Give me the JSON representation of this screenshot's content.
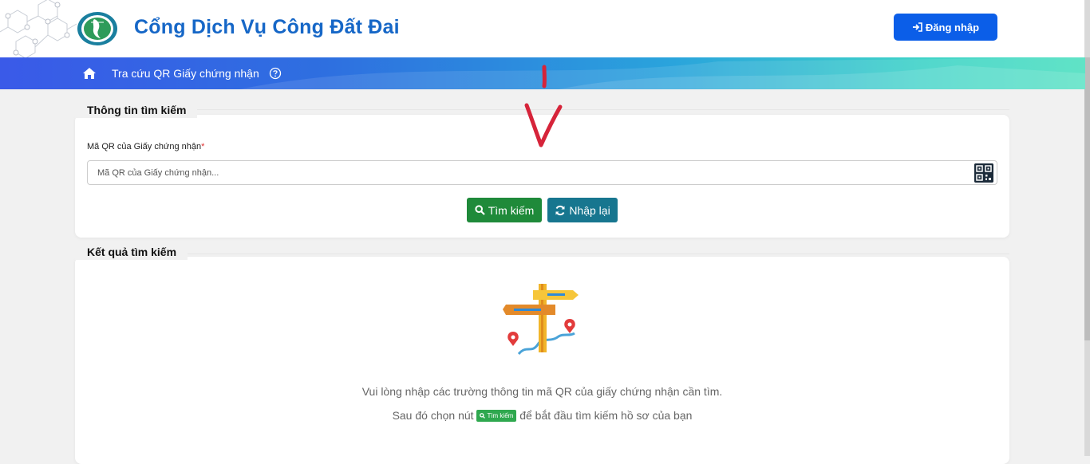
{
  "header": {
    "site_title": "Cổng Dịch Vụ Công Đất Đai",
    "login_label": "Đăng nhập"
  },
  "nav": {
    "link_label": "Tra cứu QR Giấy chứng nhận"
  },
  "search_section": {
    "title": "Thông tin tìm kiếm",
    "field_label": "Mã QR của Giấy chứng nhận",
    "required_mark": "*",
    "field_placeholder": "Mã QR của Giấy chứng nhận...",
    "field_value": "",
    "search_button": "Tìm kiếm",
    "reset_button": "Nhập lại"
  },
  "results_section": {
    "title": "Kết quả tìm kiếm",
    "message_line1": "Vui lòng nhập các trường thông tin mã QR của giấy chứng nhận cần tìm.",
    "message_line2_before": "Sau đó chọn nút",
    "inline_button": "Tìm kiếm",
    "message_line2_after": "để bắt đầu tìm kiếm hồ sơ của bạn"
  },
  "colors": {
    "brand_blue": "#1667c7",
    "login_blue": "#0b5ee8",
    "search_green": "#1f8a3a",
    "reset_teal": "#17768f",
    "annotation_red": "#d6243a"
  },
  "icons": {
    "home": "home-icon",
    "help": "question-circle-icon",
    "login": "sign-in-icon",
    "qr": "qr-code-icon",
    "search": "search-icon",
    "refresh": "refresh-icon"
  }
}
